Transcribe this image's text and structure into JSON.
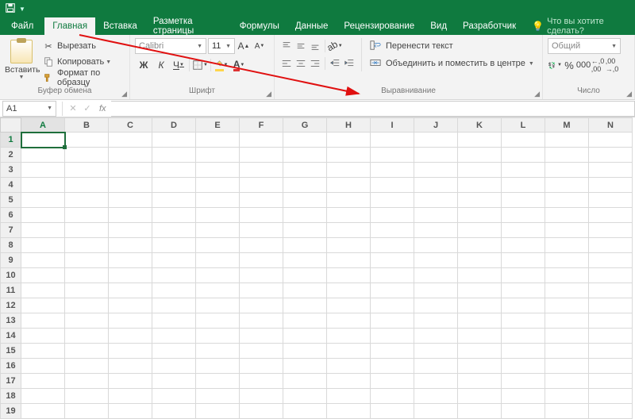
{
  "titlebar": {
    "save_icon": "💾"
  },
  "tabs": {
    "file": "Файл",
    "home": "Главная",
    "insert": "Вставка",
    "layout": "Разметка страницы",
    "formulas": "Формулы",
    "data": "Данные",
    "review": "Рецензирование",
    "view": "Вид",
    "developer": "Разработчик",
    "tellme": "Что вы хотите сделать?"
  },
  "ribbon": {
    "clipboard": {
      "paste": "Вставить",
      "cut": "Вырезать",
      "copy": "Копировать",
      "format_painter": "Формат по образцу",
      "label": "Буфер обмена"
    },
    "font": {
      "name": "Calibri",
      "size": "11",
      "label": "Шрифт",
      "bold": "Ж",
      "italic": "К",
      "underline": "Ч"
    },
    "alignment": {
      "wrap": "Перенести текст",
      "merge": "Объединить и поместить в центре",
      "label": "Выравнивание"
    },
    "number": {
      "format": "Общий",
      "label": "Число"
    }
  },
  "formula_bar": {
    "name_box": "A1",
    "fx": "fx"
  },
  "grid": {
    "columns": [
      "A",
      "B",
      "C",
      "D",
      "E",
      "F",
      "G",
      "H",
      "I",
      "J",
      "K",
      "L",
      "M",
      "N"
    ],
    "rows": [
      1,
      2,
      3,
      4,
      5,
      6,
      7,
      8,
      9,
      10,
      11,
      12,
      13,
      14,
      15,
      16,
      17,
      18,
      19
    ],
    "selected": "A1"
  }
}
